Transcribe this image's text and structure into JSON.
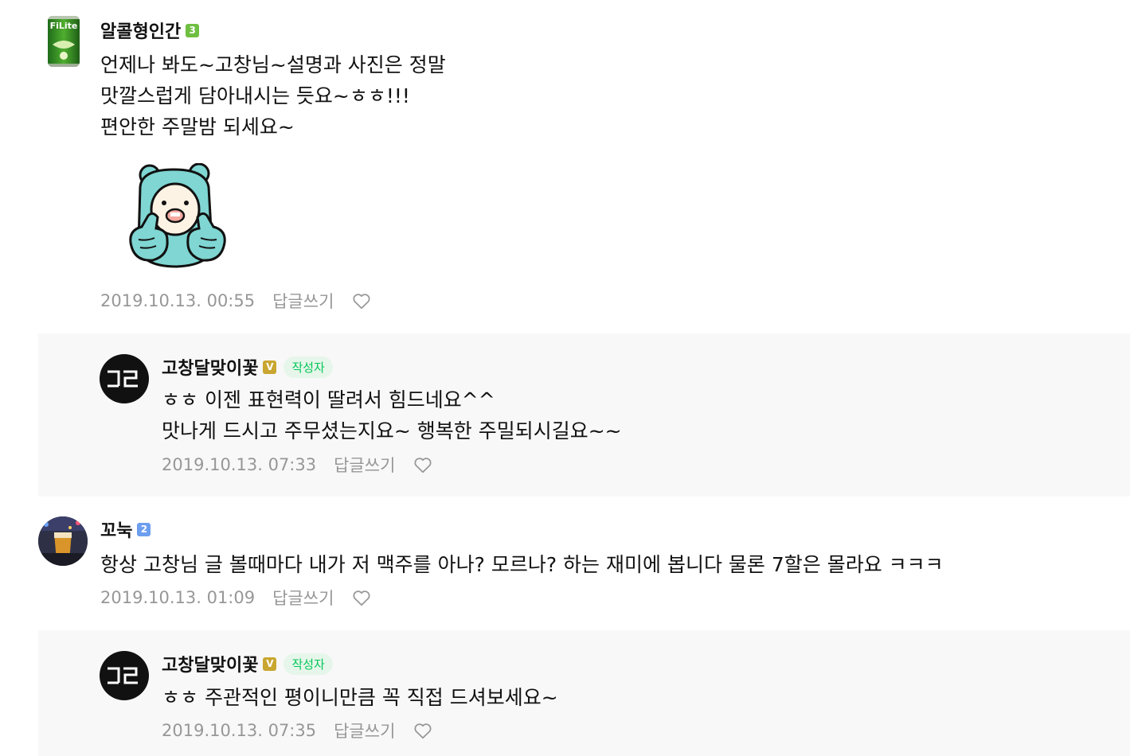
{
  "comments": [
    {
      "nickname": "알콜형인간",
      "level": "3",
      "level_color": "#6fbf40",
      "lines": [
        "언제나 봐도~고창님~설명과 사진은 정말",
        "맛깔스럽게 담아내시는 듯요~ㅎㅎ!!!",
        "편안한 주말밤 되세요~"
      ],
      "avatar_text": "FiLite",
      "date": "2019.10.13. 00:55",
      "reply_label": "답글쓰기"
    },
    {
      "nickname": "고창달맞이꽃",
      "level": "V",
      "level_color": "#c9a630",
      "author_tag": "작성자",
      "lines": [
        "ㅎㅎ 이젠 표현력이 딸려서 힘드네요^^",
        "맛나게 드시고 주무셨는지요~ 행복한 주밀되시길요~~"
      ],
      "avatar_text": "고딩",
      "date": "2019.10.13. 07:33",
      "reply_label": "답글쓰기"
    },
    {
      "nickname": "꼬눅",
      "level": "2",
      "level_color": "#6c9ef0",
      "lines": [
        "항상 고창님 글 볼때마다 내가 저 맥주를 아나? 모르나? 하는 재미에 봅니다 물론 7할은 몰라요 ㅋㅋㅋ"
      ],
      "date": "2019.10.13. 01:09",
      "reply_label": "답글쓰기"
    },
    {
      "nickname": "고창달맞이꽃",
      "level": "V",
      "level_color": "#c9a630",
      "author_tag": "작성자",
      "lines": [
        "ㅎㅎ 주관적인 평이니만큼 꼭 직접 드셔보세요~"
      ],
      "avatar_text": "고딩",
      "date": "2019.10.13. 07:35",
      "reply_label": "답글쓰기"
    }
  ],
  "colors": {
    "author_tag_bg": "#e7f6ea",
    "author_tag_text": "#03c75a",
    "meta_text": "#979797",
    "reply_bg": "#f8f8f8",
    "sticker_body": "#7fd6d2"
  },
  "icons": {
    "heart": "heart-outline-icon",
    "sticker": "bear-thumbs-up-sticker"
  }
}
